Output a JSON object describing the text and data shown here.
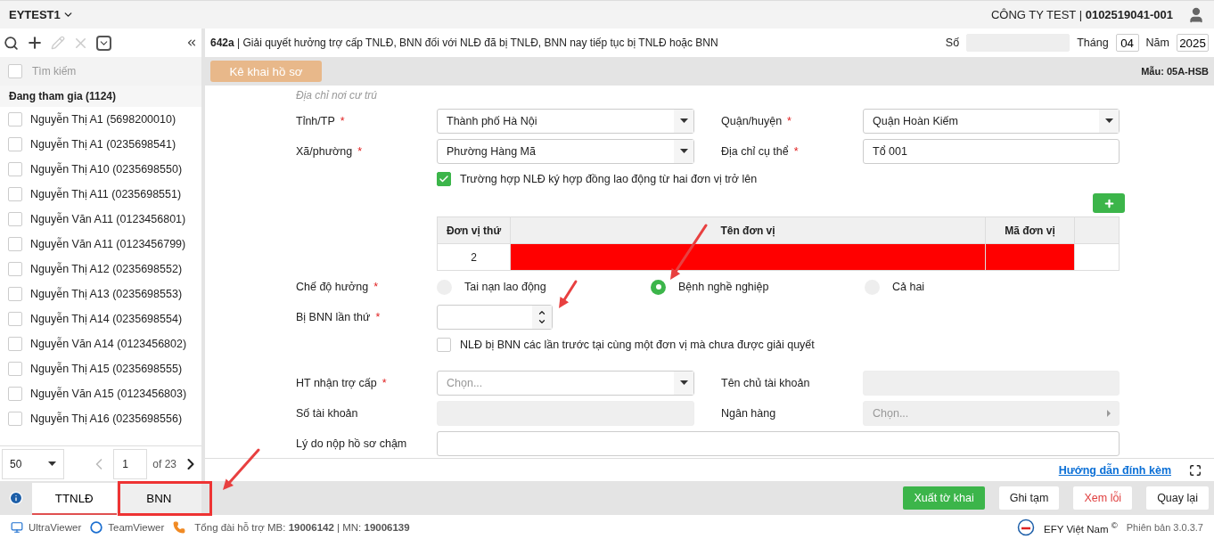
{
  "header": {
    "company_selector": "EYTEST1",
    "company": "CÔNG TY TEST | ",
    "tax_code": "0102519041-001"
  },
  "sidebar": {
    "search": {
      "placeholder": "Tìm kiếm",
      "checked": false
    },
    "group": "Đang tham gia (1124)",
    "items": [
      {
        "label": "Nguyễn Thị A1 (5698200010)",
        "checked": false
      },
      {
        "label": "Nguyễn Thị A1 (0235698541)",
        "checked": false
      },
      {
        "label": "Nguyễn Thị A10 (0235698550)",
        "checked": false
      },
      {
        "label": "Nguyễn Thị A11 (0235698551)",
        "checked": false
      },
      {
        "label": "Nguyễn Văn A11 (0123456801)",
        "checked": false
      },
      {
        "label": "Nguyễn Văn A11 (0123456799)",
        "checked": false
      },
      {
        "label": "Nguyễn Thị A12 (0235698552)",
        "checked": false
      },
      {
        "label": "Nguyễn Thị A13 (0235698553)",
        "checked": false
      },
      {
        "label": "Nguyễn Thị A14 (0235698554)",
        "checked": false
      },
      {
        "label": "Nguyễn Văn A14 (0123456802)",
        "checked": false
      },
      {
        "label": "Nguyễn Thị A15 (0235698555)",
        "checked": false
      },
      {
        "label": "Nguyễn Văn A15 (0123456803)",
        "checked": false
      },
      {
        "label": "Nguyễn Thị A16 (0235698556)",
        "checked": false
      }
    ],
    "pagination": {
      "page_size": "50",
      "page": "1",
      "total": "of 23"
    },
    "tabs": [
      {
        "label": "TTNLĐ",
        "selected": true
      },
      {
        "label": "BNN",
        "selected": false
      }
    ]
  },
  "form": {
    "title": "**642a** | Giải quyết hưởng trợ cấp TNLĐ, BNN đối với NLĐ đã bị TNLĐ, BNN nay tiếp tục bị TNLĐ hoặc BNN",
    "number_label": "Số",
    "month_label": "Tháng",
    "month": "04",
    "year_label": "Năm",
    "year": "2025",
    "declare_button": "Kê khai hồ sơ",
    "template": "Mẫu: 05A-HSB",
    "section": "Địa chỉ nơi cư trú",
    "address_rows": [
      [
        {
          "label": "Tỉnh/TP",
          "required_mark": "*",
          "kind": "select",
          "value": "Thành phố Hà Nội"
        },
        {
          "label": "Quận/huyện",
          "required_mark": "*",
          "kind": "select",
          "value": "Quận Hoàn Kiếm"
        }
      ],
      [
        {
          "label": "Xã/phường",
          "required_mark": "*",
          "kind": "select",
          "value": "Phường Hàng Mã"
        },
        {
          "label": "Địa chỉ cụ thể",
          "required_mark": "*",
          "kind": "text",
          "value": "Tổ 001"
        }
      ]
    ],
    "multi_employer": {
      "label": "Trường hợp NLĐ ký hợp đồng lao động từ hai đơn vị trở lên",
      "checked": true
    },
    "units_table": {
      "columns": [
        "Đơn vị thứ",
        "Tên đơn vị",
        "Mã đơn vị"
      ],
      "rows": [
        [
          {
            "text": "2",
            "invalid": false
          },
          {
            "invalid": true
          },
          {
            "invalid": true
          }
        ]
      ]
    },
    "regime": {
      "label": "Chế độ hưởng",
      "required_mark": "*",
      "options": [
        {
          "label": "Tai nạn lao động",
          "selected": false
        },
        {
          "label": "Bệnh nghề nghiệp",
          "selected": true
        },
        {
          "label": "Cả hai",
          "selected": false
        }
      ]
    },
    "occurrence": {
      "label": "Bị BNN lần thứ",
      "required_mark": "*"
    },
    "unresolved": {
      "label": "NLĐ bị BNN các lần trước tại cùng một đơn vị mà chưa được giải quyết",
      "checked": false
    },
    "payment_rows": [
      [
        {
          "label": "HT nhận trợ cấp",
          "required_mark": "*",
          "kind": "select",
          "placeholder": "Chọn..."
        },
        {
          "label": "Tên chủ tài khoản",
          "kind": "disabled"
        }
      ],
      [
        {
          "label": "Số tài khoản",
          "kind": "disabled"
        },
        {
          "label": "Ngân hàng",
          "kind": "disabled-select",
          "placeholder": "Chọn..."
        }
      ]
    ],
    "late_reason": {
      "label": "Lý do nộp hồ sơ chậm"
    },
    "guide_link": "Hướng dẫn đính kèm",
    "actions": [
      {
        "label": "Xuất tờ khai",
        "kind": "primary"
      },
      {
        "label": "Ghi tạm",
        "kind": "default"
      },
      {
        "label": "Xem lỗi",
        "kind": "danger"
      },
      {
        "label": "Quay lại",
        "kind": "default"
      }
    ]
  },
  "status_bar": {
    "tools": [
      "UltraViewer",
      "TeamViewer"
    ],
    "hotline": "Tổng đài hỗ trợ MB: **19006142** | MN: **19006139**",
    "brand": "EFY Việt Nam",
    "brand_mark": "©",
    "version": "Phiên bản 3.0.3.7"
  }
}
